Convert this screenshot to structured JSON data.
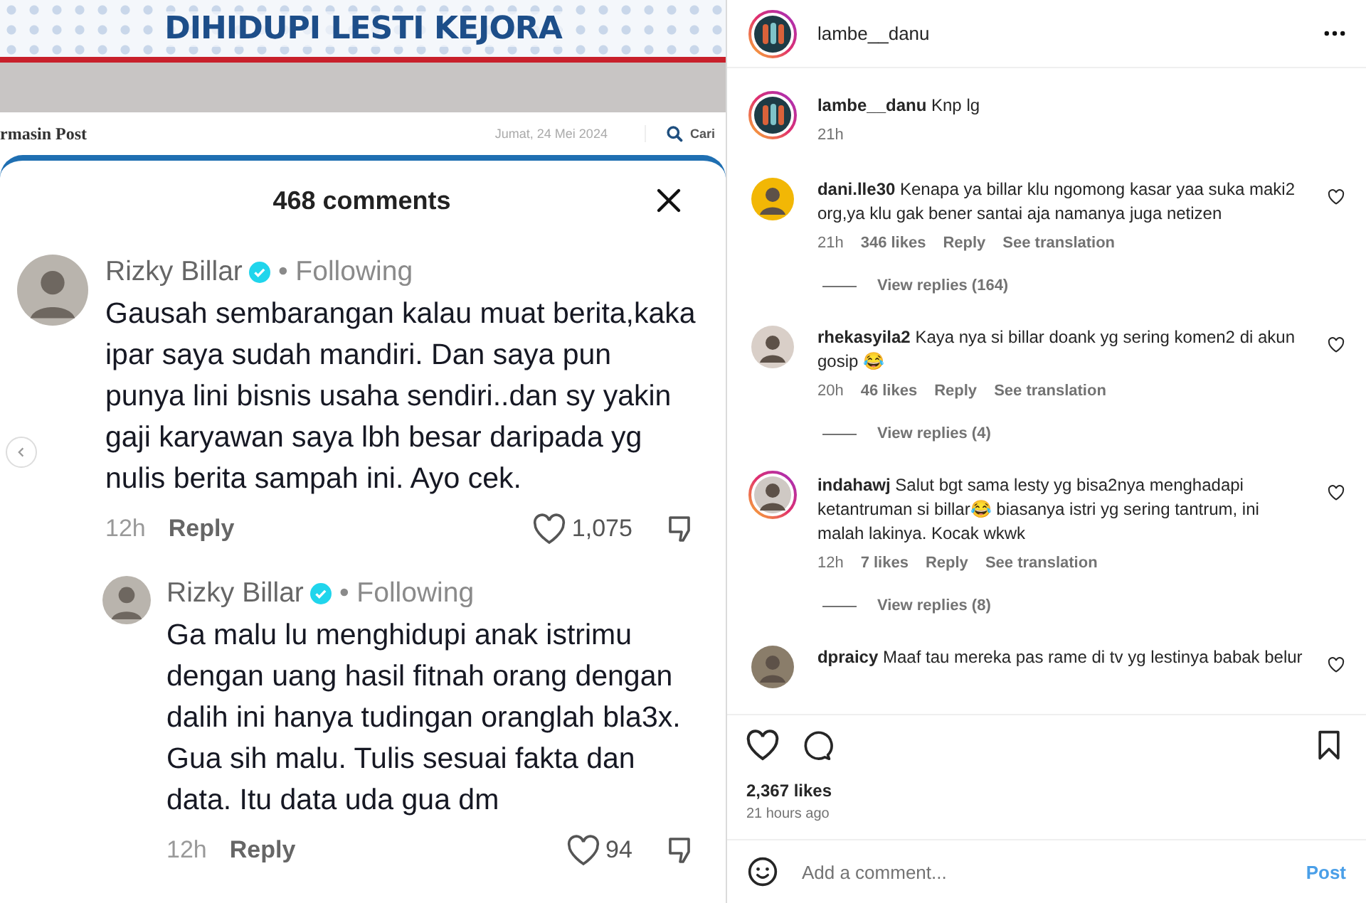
{
  "post_image": {
    "headline": "DIHIDUPI LESTI KEJORA",
    "site_logo": "rmasin Post",
    "date": "Jumat, 24 Mei 2024",
    "search_label": "Cari",
    "sheet": {
      "title": "468 comments",
      "comments": [
        {
          "user": "Rizky Billar",
          "verified": true,
          "relation": "• Following",
          "text": "Gausah sembarangan kalau muat berita,kaka ipar saya sudah mandiri. Dan saya pun punya lini bisnis usaha sendiri..dan sy yakin gaji karyawan saya lbh besar daripada yg nulis berita sampah ini. Ayo cek.",
          "time": "12h",
          "reply": "Reply",
          "likes": "1,075",
          "replies": [
            {
              "user": "Rizky Billar",
              "verified": true,
              "relation": "• Following",
              "text": "Ga malu lu menghidupi anak istrimu dengan uang hasil fitnah orang dengan dalih ini hanya tudingan oranglah bla3x. Gua sih malu. Tulis sesuai fakta dan data. Itu data uda gua dm",
              "time": "12h",
              "reply": "Reply",
              "likes": "94"
            }
          ]
        }
      ]
    }
  },
  "header": {
    "username": "lambe__danu"
  },
  "caption": {
    "username": "lambe__danu",
    "text": "Knp lg",
    "time": "21h",
    "story_ring": true
  },
  "comments": [
    {
      "username": "dani.lle30",
      "text": "Kenapa ya billar klu ngomong kasar yaa suka maki2 org,ya klu gak bener santai aja namanya juga netizen",
      "time": "21h",
      "likes": "346 likes",
      "reply": "Reply",
      "translate": "See translation",
      "view_replies": "View replies (164)",
      "story_ring": false
    },
    {
      "username": "rhekasyila2",
      "text": "Kaya nya si billar doank yg sering komen2 di akun gosip 😂",
      "time": "20h",
      "likes": "46 likes",
      "reply": "Reply",
      "translate": "See translation",
      "view_replies": "View replies (4)",
      "story_ring": false
    },
    {
      "username": "indahawj",
      "text": "Salut bgt sama lesty yg bisa2nya menghadapi ketantruman si billar😂 biasanya istri yg sering tantrum, ini malah lakinya. Kocak wkwk",
      "time": "12h",
      "likes": "7 likes",
      "reply": "Reply",
      "translate": "See translation",
      "view_replies": "View replies (8)",
      "story_ring": true
    },
    {
      "username": "dpraicy",
      "text": "Maaf tau mereka pas rame di tv yg lestinya babak belur",
      "story_ring": false
    }
  ],
  "likes": "2,367 likes",
  "time_ago": "21 hours ago",
  "comment_box": {
    "placeholder": "Add a comment...",
    "post": "Post"
  }
}
